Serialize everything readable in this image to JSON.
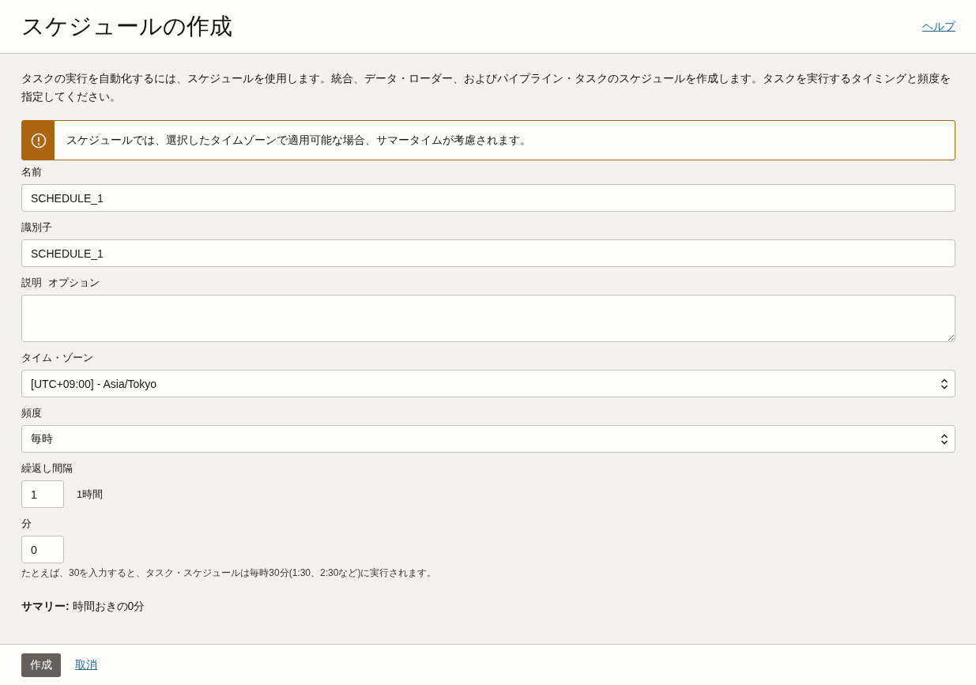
{
  "header": {
    "title": "スケジュールの作成",
    "help_link": "ヘルプ"
  },
  "intro": "タスクの実行を自動化するには、スケジュールを使用します。統合、データ・ローダー、およびパイプライン・タスクのスケジュールを作成します。タスクを実行するタイミングと頻度を指定してください。",
  "notice": {
    "kind": "warning",
    "text": "スケジュールでは、選択したタイムゾーンで適用可能な場合、サマータイムが考慮されます。"
  },
  "fields": [
    {
      "kind": "text",
      "label": "名前",
      "value": "SCHEDULE_1"
    },
    {
      "kind": "text",
      "label": "識別子",
      "value": "SCHEDULE_1"
    },
    {
      "kind": "textarea",
      "label": "説明",
      "optional_tag": "オプション"
    },
    {
      "kind": "select",
      "label": "タイム・ゾーン",
      "value": "[UTC+09:00] - Asia/Tokyo"
    },
    {
      "kind": "select",
      "label": "頻度",
      "value": "毎時"
    },
    {
      "kind": "number",
      "label": "繰返し間隔",
      "value": "1",
      "suffix": "1時間"
    },
    {
      "kind": "number",
      "label": "分",
      "value": "0",
      "hint": "たとえば、30を入力すると、タスク・スケジュールは毎時30分(1:30、2:30など)に実行されます。"
    }
  ],
  "summary": "**サマリー:** 時間おきの0分",
  "footer": {
    "create_button": "作成",
    "cancel_link": "取消"
  }
}
